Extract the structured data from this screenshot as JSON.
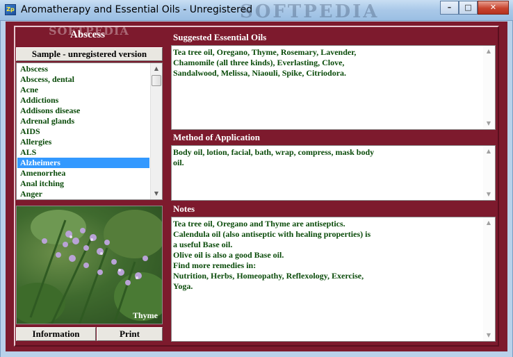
{
  "window": {
    "title": "Aromatherapy and Essential Oils - Unregistered",
    "icon_text": "Zp",
    "watermark": "SOFTPEDIA",
    "controls": {
      "minimize": "–",
      "maximize": "□",
      "close": "✕"
    }
  },
  "sidebar": {
    "selected_heading": "Abscess",
    "watermark": "SOFTPEDIA",
    "sample_button": "Sample - unregistered version",
    "items": [
      {
        "label": "Abscess"
      },
      {
        "label": "Abscess, dental"
      },
      {
        "label": "Acne"
      },
      {
        "label": "Addictions"
      },
      {
        "label": "Addisons disease"
      },
      {
        "label": "Adrenal glands"
      },
      {
        "label": "AIDS"
      },
      {
        "label": "Allergies"
      },
      {
        "label": "ALS"
      },
      {
        "label": "Alzheimers"
      },
      {
        "label": "Amenorrhea"
      },
      {
        "label": "Anal itching"
      },
      {
        "label": "Anger"
      }
    ],
    "selected_index": 9,
    "photo_caption": "Thyme",
    "info_button": "Information",
    "print_button": "Print"
  },
  "panels": {
    "suggested": {
      "label": "Suggested Essential Oils",
      "text": "Tea tree oil, Oregano, Thyme, Rosemary, Lavender,\nChamomile (all three kinds), Everlasting, Clove,\nSandalwood, Melissa, Niaouli, Spike, Citriodora."
    },
    "method": {
      "label": "Method of Application",
      "text": "Body oil, lotion, facial, bath, wrap, compress, mask body\noil."
    },
    "notes": {
      "label": "Notes",
      "text": "Tea tree oil, Oregano and Thyme are antiseptics.\nCalendula oil (also antiseptic with healing properties) is\na useful Base oil.\nOlive oil is also a good Base oil.\nFind more remedies in:\nNutrition, Herbs, Homeopathy, Reflexology, Exercise,\nYoga."
    }
  },
  "colors": {
    "background": "#7d1a2d",
    "text_green": "#0a4b0a",
    "selection": "#3399ff"
  },
  "icons": {
    "scroll_up": "▲",
    "scroll_down": "▼"
  }
}
